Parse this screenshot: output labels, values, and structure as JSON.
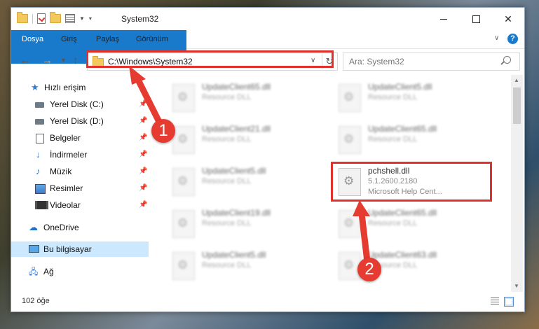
{
  "window": {
    "title": "System32"
  },
  "ribbon": {
    "tabs": [
      "Dosya",
      "Giriş",
      "Paylaş",
      "Görünüm"
    ],
    "help": "?"
  },
  "address_bar": {
    "path": "C:\\Windows\\System32",
    "search_placeholder": "Ara: System32"
  },
  "sidebar": {
    "quick_access": "Hızlı erişim",
    "items": [
      {
        "label": "Yerel Disk (C:)",
        "icon": "drive-icon",
        "pinned": true
      },
      {
        "label": "Yerel Disk (D:)",
        "icon": "drive-icon",
        "pinned": true
      },
      {
        "label": "Belgeler",
        "icon": "documents-icon",
        "pinned": true
      },
      {
        "label": "İndirmeler",
        "icon": "downloads-icon",
        "pinned": true
      },
      {
        "label": "Müzik",
        "icon": "music-icon",
        "pinned": true
      },
      {
        "label": "Resimler",
        "icon": "pictures-icon",
        "pinned": true
      },
      {
        "label": "Videolar",
        "icon": "videos-icon",
        "pinned": true
      }
    ],
    "onedrive": "OneDrive",
    "this_pc": "Bu bilgisayar",
    "network": "Ağ"
  },
  "files": {
    "left": [
      {
        "name": "UpdateClient65.dll",
        "desc": "Resource DLL"
      },
      {
        "name": "UpdateClient21.dll",
        "desc": "Resource DLL"
      },
      {
        "name": "UpdateClient5.dll",
        "desc": "Resource DLL"
      },
      {
        "name": "UpdateClient19.dll",
        "desc": "Resource DLL"
      },
      {
        "name": "UpdateClient5.dll",
        "desc": "Resource DLL"
      }
    ],
    "right": [
      {
        "name": "UpdateClient5.dll",
        "desc": "Resource DLL"
      },
      {
        "name": "UpdateClient65.dll",
        "desc": "Resource DLL"
      },
      {
        "name": "pchshell.dll",
        "version": "5.1.2600.2180",
        "desc": "Microsoft Help Cent..."
      },
      {
        "name": "UpdateClient65.dll",
        "desc": "Resource DLL"
      },
      {
        "name": "UpdateClient63.dll",
        "desc": "Resource DLL"
      }
    ]
  },
  "status": {
    "item_count": "102 öğe"
  },
  "annotations": {
    "step1": "1",
    "step2": "2",
    "color": "#e0322c"
  }
}
